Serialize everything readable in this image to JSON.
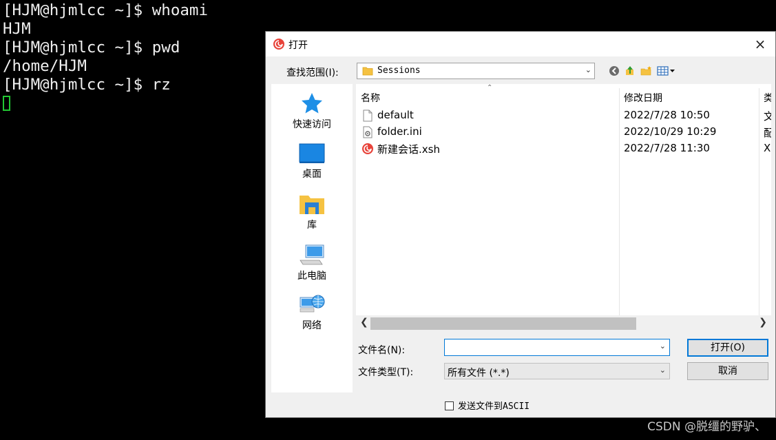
{
  "terminal": {
    "lines": [
      "[HJM@hjmlcc ~]$ whoami",
      "HJM",
      "[HJM@hjmlcc ~]$ pwd",
      "/home/HJM",
      "[HJM@hjmlcc ~]$ rz"
    ]
  },
  "watermark": "CSDN @脱缰的野驴、",
  "dialog": {
    "title": "打开",
    "close_icon": "×",
    "look_in_label": "查找范围(I):",
    "look_in_value": "Sessions",
    "places": [
      {
        "label": "快速访问",
        "icon": "star-icon"
      },
      {
        "label": "桌面",
        "icon": "desktop-icon"
      },
      {
        "label": "库",
        "icon": "library-icon"
      },
      {
        "label": "此电脑",
        "icon": "computer-icon"
      },
      {
        "label": "网络",
        "icon": "network-icon"
      }
    ],
    "columns": {
      "name": "名称",
      "date": "修改日期",
      "type": "类"
    },
    "files": [
      {
        "name": "default",
        "date": "2022/7/28 10:50",
        "type": "文",
        "icon": "file-icon"
      },
      {
        "name": "folder.ini",
        "date": "2022/10/29 10:29",
        "type": "配",
        "icon": "settings-file-icon"
      },
      {
        "name": "新建会话.xsh",
        "date": "2022/7/28 11:30",
        "type": "X",
        "icon": "xshell-session-icon"
      }
    ],
    "file_name_label": "文件名(N):",
    "file_name_value": "",
    "file_type_label": "文件类型(T):",
    "file_type_value": "所有文件 (*.*)",
    "open_button": "打开(O)",
    "cancel_button": "取消",
    "ascii_checkbox_label": "发送文件到ASCII",
    "ascii_checked": false
  }
}
